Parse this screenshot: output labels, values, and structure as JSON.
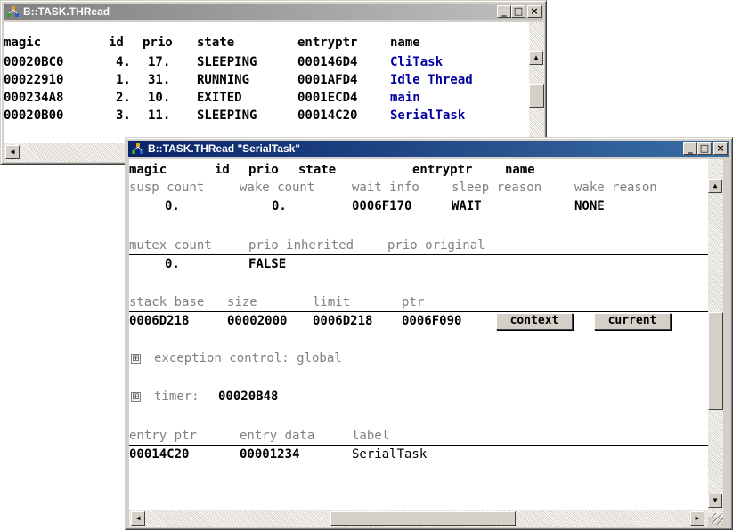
{
  "task_list_window": {
    "title": "B::TASK.THRead",
    "columns": [
      "magic",
      "id",
      "prio",
      "state",
      "entryptr",
      "name"
    ],
    "rows": [
      {
        "magic": "00020BC0",
        "id": "4.",
        "prio": "17.",
        "state": "SLEEPING",
        "entryptr": "000146D4",
        "name": "CliTask"
      },
      {
        "magic": "00022910",
        "id": "1.",
        "prio": "31.",
        "state": "RUNNING",
        "entryptr": "0001AFD4",
        "name": "Idle Thread"
      },
      {
        "magic": "000234A8",
        "id": "2.",
        "prio": "10.",
        "state": "EXITED",
        "entryptr": "0001ECD4",
        "name": "main"
      },
      {
        "magic": "00020B00",
        "id": "3.",
        "prio": "11.",
        "state": "SLEEPING",
        "entryptr": "00014C20",
        "name": "SerialTask"
      }
    ]
  },
  "detail_window": {
    "title": "B::TASK.THRead \"SerialTask\"",
    "header_columns": [
      "magic",
      "id",
      "prio",
      "state",
      "entryptr",
      "name"
    ],
    "counts_section": {
      "labels": [
        "susp count",
        "wake count",
        "wait info",
        "sleep reason",
        "wake reason"
      ],
      "values": [
        "0.",
        "0.",
        "0006F170",
        "WAIT",
        "NONE"
      ]
    },
    "mutex_section": {
      "labels": [
        "mutex count",
        "prio inherited",
        "prio original"
      ],
      "values": [
        "0.",
        "FALSE"
      ]
    },
    "stack_section": {
      "labels": [
        "stack base",
        "size",
        "limit",
        "ptr"
      ],
      "values": [
        "0006D218",
        "00002000",
        "0006D218",
        "0006F090"
      ],
      "context_button": "context",
      "current_button": "current"
    },
    "exception_control": {
      "expand_symbol": "⊞",
      "label": "exception control: global"
    },
    "timer": {
      "expand_symbol": "⊞",
      "label": "timer:",
      "value": "00020B48"
    },
    "entry_section": {
      "labels": [
        "entry ptr",
        "entry data",
        "label"
      ],
      "values": [
        "00014C20",
        "00001234",
        "SerialTask"
      ]
    }
  },
  "window_buttons": {
    "minimize": "_",
    "maximize": "□",
    "close": "×"
  },
  "scroll_arrows": {
    "up": "▲",
    "down": "▼",
    "left": "◀",
    "right": "▶"
  },
  "icons": {
    "app_icon": "trace32-app-icon"
  },
  "colors": {
    "title_active": "#0a246a",
    "link_blue": "#0000a0",
    "label_gray": "#808080",
    "window_face": "#d4d0c8"
  }
}
